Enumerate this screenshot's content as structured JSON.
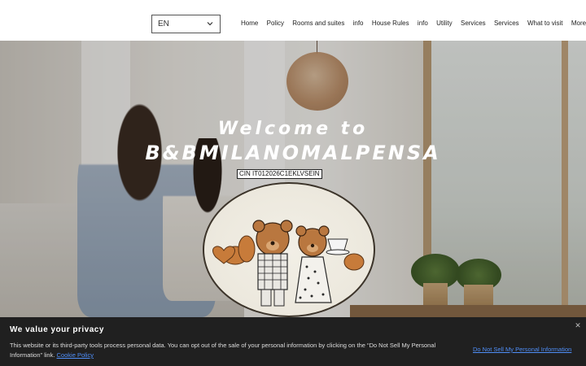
{
  "header": {
    "language": "EN",
    "nav": [
      "Home",
      "Policy",
      "Rooms and suites",
      "info",
      "House Rules",
      "info",
      "Utility",
      "Services",
      "Services",
      "What to visit",
      "More"
    ]
  },
  "hero": {
    "welcome": "Welcome to",
    "brand": "B&BMILANOMALPENSA",
    "cin": "CIN IT012026C1EKLVSEIN"
  },
  "cookie_banner": {
    "title": "We value your privacy",
    "text": "This website or its third-party tools process personal data. You can opt out of the sale of your personal information by clicking on the “Do Not Sell My Personal Information” link.",
    "policy_link": "Cookie Policy",
    "do_not_sell_link": "Do Not Sell My Personal Information"
  },
  "icons": {
    "language_dropdown": "chevron-down-icon",
    "banner_close": "close-icon"
  },
  "colors": {
    "header_bg": "#ffffff",
    "banner_bg": "#202020",
    "link": "#4f8ef7"
  }
}
